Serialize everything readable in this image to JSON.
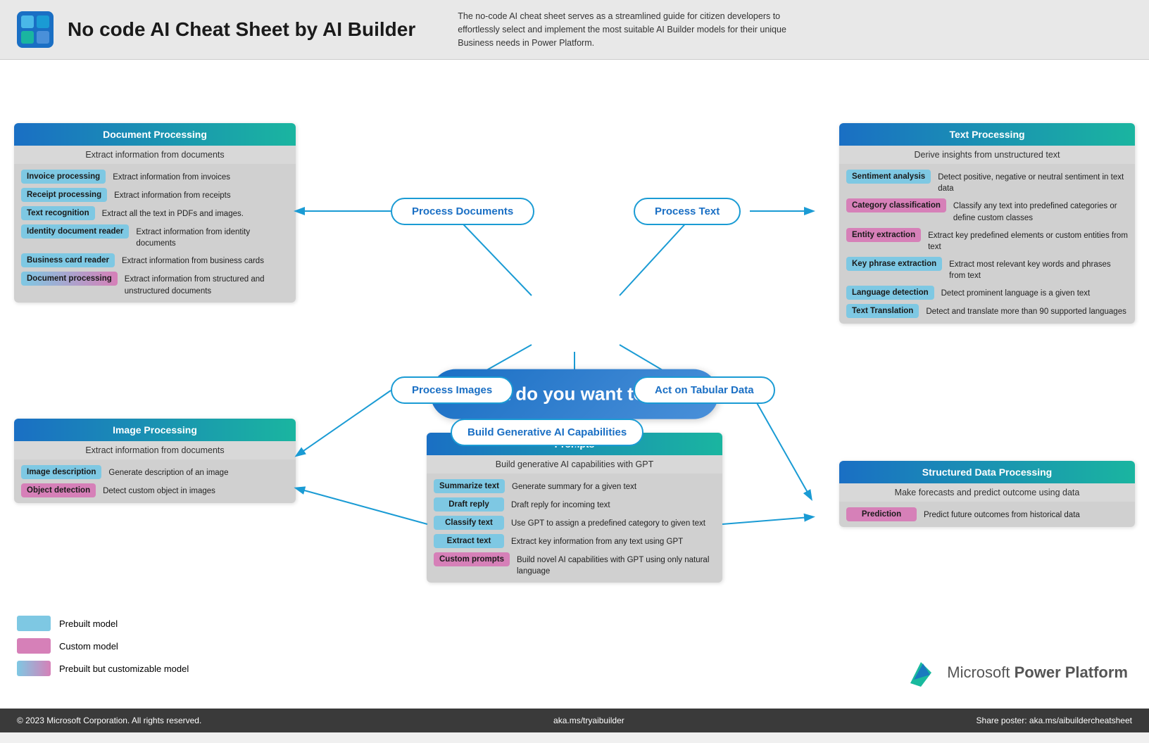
{
  "header": {
    "title": "No code AI Cheat Sheet by AI Builder",
    "description": "The no-code AI cheat sheet serves as a streamlined guide for citizen developers to effortlessly select and implement the most suitable AI Builder models for their unique Business needs in Power Platform."
  },
  "center": {
    "label": "What do you want to do?"
  },
  "branches": {
    "process_documents": "Process Documents",
    "process_text": "Process Text",
    "process_images": "Process Images",
    "act_on_tabular": "Act on Tabular Data",
    "build_generative": "Build Generative AI Capabilities"
  },
  "doc_panel": {
    "header": "Document Processing",
    "subheader": "Extract information from documents",
    "rows": [
      {
        "tag": "Invoice processing",
        "type": "blue",
        "desc": "Extract information from invoices"
      },
      {
        "tag": "Receipt processing",
        "type": "blue",
        "desc": "Extract information from receipts"
      },
      {
        "tag": "Text  recognition",
        "type": "blue",
        "desc": "Extract all the text in PDFs and images."
      },
      {
        "tag": "Identity document reader",
        "type": "blue",
        "desc": "Extract information from identity documents"
      },
      {
        "tag": "Business card reader",
        "type": "blue",
        "desc": "Extract information from business cards"
      },
      {
        "tag": "Document processing",
        "type": "gradient",
        "desc": "Extract information from structured and unstructured documents"
      }
    ]
  },
  "img_panel": {
    "header": "Image Processing",
    "subheader": "Extract information from documents",
    "rows": [
      {
        "tag": "Image description",
        "type": "blue",
        "desc": "Generate description of an image"
      },
      {
        "tag": "Object detection",
        "type": "pink",
        "desc": "Detect custom object in images"
      }
    ]
  },
  "text_panel": {
    "header": "Text Processing",
    "subheader": "Derive insights from unstructured text",
    "rows": [
      {
        "tag": "Sentiment analysis",
        "type": "blue",
        "desc": "Detect positive, negative or neutral sentiment in text data"
      },
      {
        "tag": "Category classification",
        "type": "pink",
        "desc": "Classify any text into predefined categories or define custom classes"
      },
      {
        "tag": "Entity extraction",
        "type": "pink",
        "desc": "Extract key predefined elements or custom entities from text"
      },
      {
        "tag": "Key phrase extraction",
        "type": "blue",
        "desc": "Extract most relevant key words and phrases from text"
      },
      {
        "tag": "Language detection",
        "type": "blue",
        "desc": "Detect prominent language is a given text"
      },
      {
        "tag": "Text Translation",
        "type": "blue",
        "desc": "Detect and translate more than 90 supported languages"
      }
    ]
  },
  "struct_panel": {
    "header": "Structured Data Processing",
    "subheader": "Make forecasts and predict outcome using data",
    "rows": [
      {
        "tag": "Prediction",
        "type": "pink",
        "desc": "Predict future outcomes from historical data"
      }
    ]
  },
  "prompts_panel": {
    "header": "Prompts",
    "subheader": "Build generative AI capabilities with GPT",
    "rows": [
      {
        "tag": "Summarize text",
        "type": "blue",
        "desc": "Generate summary for a given text"
      },
      {
        "tag": "Draft reply",
        "type": "blue",
        "desc": "Draft reply for incoming text"
      },
      {
        "tag": "Classify text",
        "type": "blue",
        "desc": "Use GPT to assign a predefined category to given text"
      },
      {
        "tag": "Extract text",
        "type": "blue",
        "desc": "Extract key information from any text using GPT"
      },
      {
        "tag": "Custom prompts",
        "type": "pink",
        "desc": "Build novel AI capabilities with GPT using only natural language"
      }
    ]
  },
  "legend": [
    {
      "label": "Prebuilt model",
      "type": "blue"
    },
    {
      "label": "Custom model",
      "type": "pink"
    },
    {
      "label": "Prebuilt but customizable model",
      "type": "gradient"
    }
  ],
  "footer": {
    "copyright": "© 2023 Microsoft Corporation. All rights reserved.",
    "link": "aka.ms/tryaibuilder",
    "share": "Share poster: aka.ms/aibuildercheatsheet"
  },
  "pp": {
    "brand": "Microsoft Power Platform"
  }
}
